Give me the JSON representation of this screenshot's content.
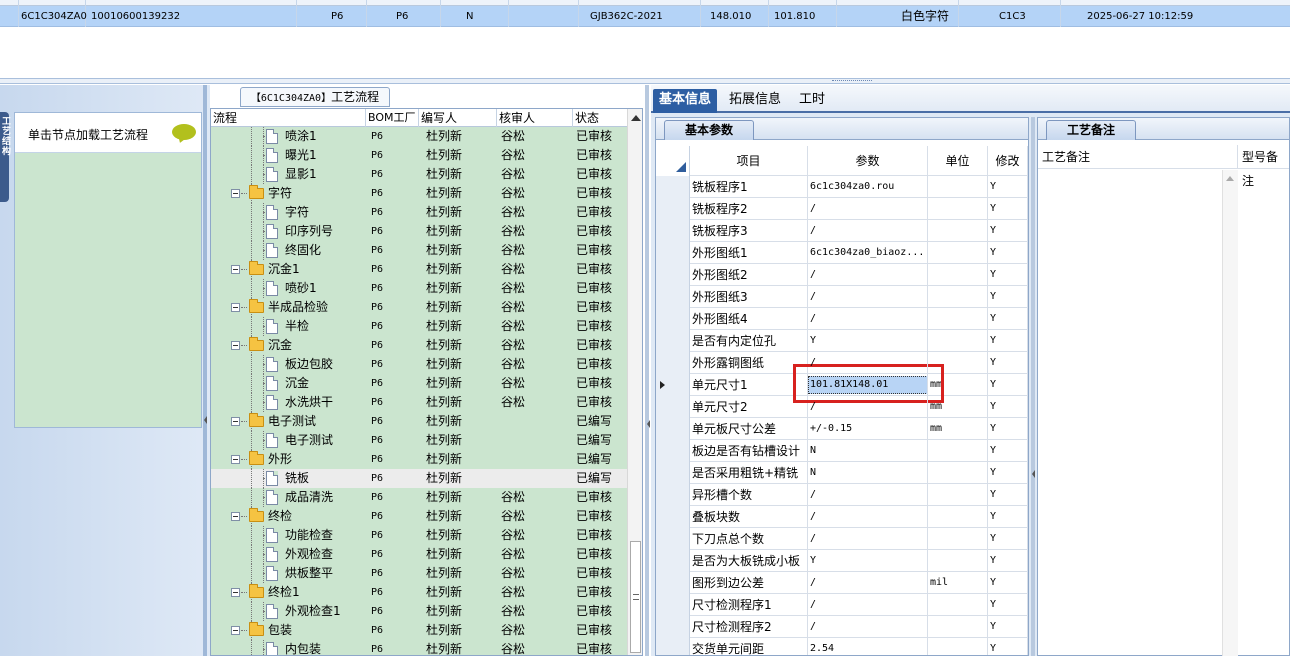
{
  "top_row": {
    "cells": [
      "6C1C304ZA0",
      "10010600139232",
      "P6",
      "P6",
      "N",
      "GJB362C-2021",
      "148.010",
      "101.810",
      "白色字符",
      "C1C3",
      "2025-06-27 10:12:59"
    ]
  },
  "left_panel": {
    "side_tab": "工艺结构",
    "hint_text": "单击节点加载工艺流程",
    "icon": "speech-bubble-icon"
  },
  "tree": {
    "title_code": "【6C1C304ZA0】",
    "title_text": "工艺流程",
    "columns": [
      "流程",
      "BOM工厂",
      "编写人",
      "核审人",
      "状态"
    ],
    "rows": [
      {
        "name": "喷涂1",
        "level": 2,
        "type": "file",
        "bom": "P6",
        "writer": "杜列新",
        "checker": "谷松",
        "state": "已审核"
      },
      {
        "name": "曝光1",
        "level": 2,
        "type": "file",
        "bom": "P6",
        "writer": "杜列新",
        "checker": "谷松",
        "state": "已审核"
      },
      {
        "name": "显影1",
        "level": 2,
        "type": "file",
        "bom": "P6",
        "writer": "杜列新",
        "checker": "谷松",
        "state": "已审核"
      },
      {
        "name": "字符",
        "level": 1,
        "type": "folder",
        "bom": "P6",
        "writer": "杜列新",
        "checker": "谷松",
        "state": "已审核"
      },
      {
        "name": "字符",
        "level": 2,
        "type": "file",
        "bom": "P6",
        "writer": "杜列新",
        "checker": "谷松",
        "state": "已审核"
      },
      {
        "name": "印序列号",
        "level": 2,
        "type": "file",
        "bom": "P6",
        "writer": "杜列新",
        "checker": "谷松",
        "state": "已审核"
      },
      {
        "name": "终固化",
        "level": 2,
        "type": "file",
        "bom": "P6",
        "writer": "杜列新",
        "checker": "谷松",
        "state": "已审核"
      },
      {
        "name": "沉金1",
        "level": 1,
        "type": "folder",
        "bom": "P6",
        "writer": "杜列新",
        "checker": "谷松",
        "state": "已审核"
      },
      {
        "name": "喷砂1",
        "level": 2,
        "type": "file",
        "bom": "P6",
        "writer": "杜列新",
        "checker": "谷松",
        "state": "已审核"
      },
      {
        "name": "半成品检验",
        "level": 1,
        "type": "folder",
        "bom": "P6",
        "writer": "杜列新",
        "checker": "谷松",
        "state": "已审核"
      },
      {
        "name": "半检",
        "level": 2,
        "type": "file",
        "bom": "P6",
        "writer": "杜列新",
        "checker": "谷松",
        "state": "已审核"
      },
      {
        "name": "沉金",
        "level": 1,
        "type": "folder",
        "bom": "P6",
        "writer": "杜列新",
        "checker": "谷松",
        "state": "已审核"
      },
      {
        "name": "板边包胶",
        "level": 2,
        "type": "file",
        "bom": "P6",
        "writer": "杜列新",
        "checker": "谷松",
        "state": "已审核"
      },
      {
        "name": "沉金",
        "level": 2,
        "type": "file",
        "bom": "P6",
        "writer": "杜列新",
        "checker": "谷松",
        "state": "已审核"
      },
      {
        "name": "水洗烘干",
        "level": 2,
        "type": "file",
        "bom": "P6",
        "writer": "杜列新",
        "checker": "谷松",
        "state": "已审核"
      },
      {
        "name": "电子测试",
        "level": 1,
        "type": "folder",
        "bom": "P6",
        "writer": "杜列新",
        "checker": "",
        "state": "已编写"
      },
      {
        "name": "电子测试",
        "level": 2,
        "type": "file",
        "bom": "P6",
        "writer": "杜列新",
        "checker": "",
        "state": "已编写"
      },
      {
        "name": "外形",
        "level": 1,
        "type": "folder",
        "bom": "P6",
        "writer": "杜列新",
        "checker": "",
        "state": "已编写"
      },
      {
        "name": "铣板",
        "level": 2,
        "type": "file",
        "bom": "P6",
        "writer": "杜列新",
        "checker": "",
        "state": "已编写",
        "highlight": true
      },
      {
        "name": "成品清洗",
        "level": 2,
        "type": "file",
        "bom": "P6",
        "writer": "杜列新",
        "checker": "谷松",
        "state": "已审核"
      },
      {
        "name": "终检",
        "level": 1,
        "type": "folder",
        "bom": "P6",
        "writer": "杜列新",
        "checker": "谷松",
        "state": "已审核"
      },
      {
        "name": "功能检查",
        "level": 2,
        "type": "file",
        "bom": "P6",
        "writer": "杜列新",
        "checker": "谷松",
        "state": "已审核"
      },
      {
        "name": "外观检查",
        "level": 2,
        "type": "file",
        "bom": "P6",
        "writer": "杜列新",
        "checker": "谷松",
        "state": "已审核"
      },
      {
        "name": "烘板整平",
        "level": 2,
        "type": "file",
        "bom": "P6",
        "writer": "杜列新",
        "checker": "谷松",
        "state": "已审核"
      },
      {
        "name": "终检1",
        "level": 1,
        "type": "folder",
        "bom": "P6",
        "writer": "杜列新",
        "checker": "谷松",
        "state": "已审核"
      },
      {
        "name": "外观检查1",
        "level": 2,
        "type": "file",
        "bom": "P6",
        "writer": "杜列新",
        "checker": "谷松",
        "state": "已审核"
      },
      {
        "name": "包装",
        "level": 1,
        "type": "folder",
        "bom": "P6",
        "writer": "杜列新",
        "checker": "谷松",
        "state": "已审核"
      },
      {
        "name": "内包装",
        "level": 2,
        "type": "file",
        "bom": "P6",
        "writer": "杜列新",
        "checker": "谷松",
        "state": "已审核"
      }
    ]
  },
  "right": {
    "tabs": [
      "基本信息",
      "拓展信息",
      "工时"
    ],
    "active_tab": 0,
    "params_tab": "基本参数",
    "params_columns": [
      "项目",
      "参数",
      "单位",
      "修改"
    ],
    "params": [
      {
        "item": "铣板程序1",
        "value": "6c1c304za0.rou",
        "unit": "",
        "mod": "Y"
      },
      {
        "item": "铣板程序2",
        "value": "/",
        "unit": "",
        "mod": "Y"
      },
      {
        "item": "铣板程序3",
        "value": "/",
        "unit": "",
        "mod": "Y"
      },
      {
        "item": "外形图纸1",
        "value": "6c1c304za0_biaoz...",
        "unit": "",
        "mod": "Y"
      },
      {
        "item": "外形图纸2",
        "value": "/",
        "unit": "",
        "mod": "Y"
      },
      {
        "item": "外形图纸3",
        "value": "/",
        "unit": "",
        "mod": "Y"
      },
      {
        "item": "外形图纸4",
        "value": "/",
        "unit": "",
        "mod": "Y"
      },
      {
        "item": "是否有内定位孔",
        "value": "Y",
        "unit": "",
        "mod": "Y"
      },
      {
        "item": "外形露铜图纸",
        "value": "/",
        "unit": "",
        "mod": "Y"
      },
      {
        "item": "单元尺寸1",
        "value": "101.81X148.01",
        "unit": "mm",
        "mod": "Y",
        "selected": true
      },
      {
        "item": "单元尺寸2",
        "value": "/",
        "unit": "mm",
        "mod": "Y"
      },
      {
        "item": "单元板尺寸公差",
        "value": "+/-0.15",
        "unit": "mm",
        "mod": "Y"
      },
      {
        "item": "板边是否有钻槽设计",
        "value": "N",
        "unit": "",
        "mod": "Y"
      },
      {
        "item": "是否采用粗铣+精铣",
        "value": "N",
        "unit": "",
        "mod": "Y"
      },
      {
        "item": "异形槽个数",
        "value": "/",
        "unit": "",
        "mod": "Y"
      },
      {
        "item": "叠板块数",
        "value": "/",
        "unit": "",
        "mod": "Y"
      },
      {
        "item": "下刀点总个数",
        "value": "/",
        "unit": "",
        "mod": "Y"
      },
      {
        "item": "是否为大板铣成小板",
        "value": "Y",
        "unit": "",
        "mod": "Y"
      },
      {
        "item": "图形到边公差",
        "value": "/",
        "unit": "mil",
        "mod": "Y"
      },
      {
        "item": "尺寸检测程序1",
        "value": "/",
        "unit": "",
        "mod": "Y"
      },
      {
        "item": "尺寸检测程序2",
        "value": "/",
        "unit": "",
        "mod": "Y"
      },
      {
        "item": "交货单元间距",
        "value": "2.54",
        "unit": "",
        "mod": "Y"
      }
    ],
    "notes_tab": "工艺备注",
    "notes_columns": [
      "工艺备注",
      "型号备注"
    ]
  }
}
